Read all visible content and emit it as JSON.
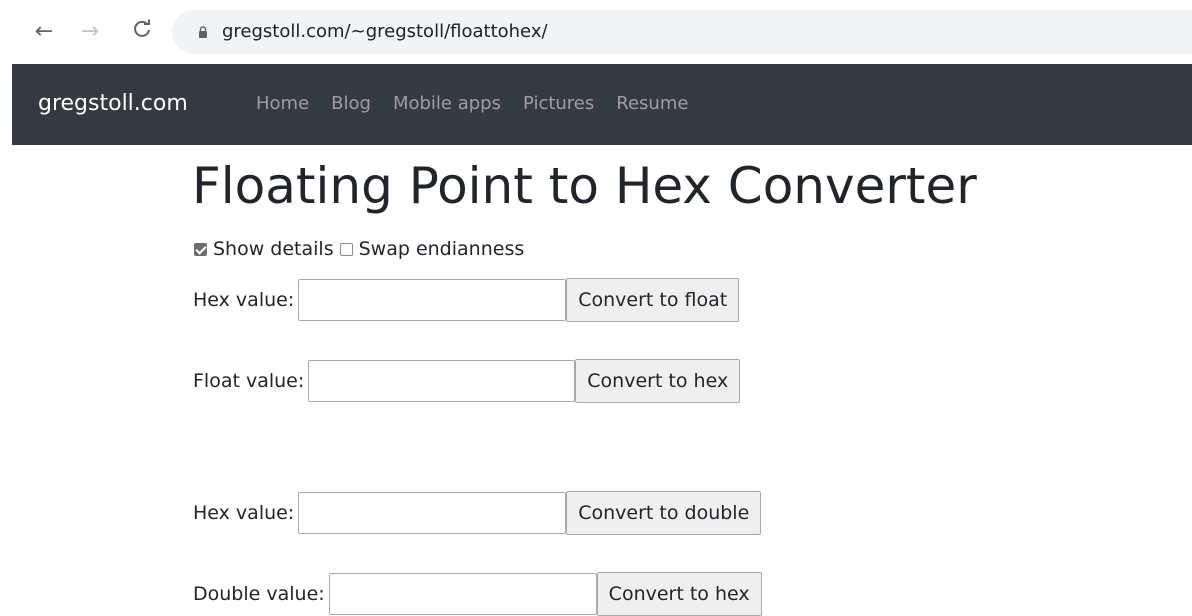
{
  "browser": {
    "back_icon": "←",
    "forward_icon": "→",
    "reload_icon": "C",
    "url": "gregstoll.com/~gregstoll/floattohex/"
  },
  "navbar": {
    "brand": "gregstoll.com",
    "links": [
      "Home",
      "Blog",
      "Mobile apps",
      "Pictures",
      "Resume"
    ],
    "background_color": "#343a40"
  },
  "page": {
    "title": "Floating Point to Hex Converter",
    "options": {
      "show_details_label": "Show details",
      "show_details_checked": true,
      "swap_endianness_label": "Swap endianness",
      "swap_endianness_checked": false
    },
    "float_hex": {
      "label": "Hex value:",
      "value": "",
      "button": "Convert to float"
    },
    "float_value": {
      "label": "Float value:",
      "value": "",
      "button": "Convert to hex"
    },
    "double_hex": {
      "label": "Hex value:",
      "value": "",
      "button": "Convert to double"
    },
    "double_value": {
      "label": "Double value:",
      "value": "",
      "button": "Convert to hex"
    }
  }
}
